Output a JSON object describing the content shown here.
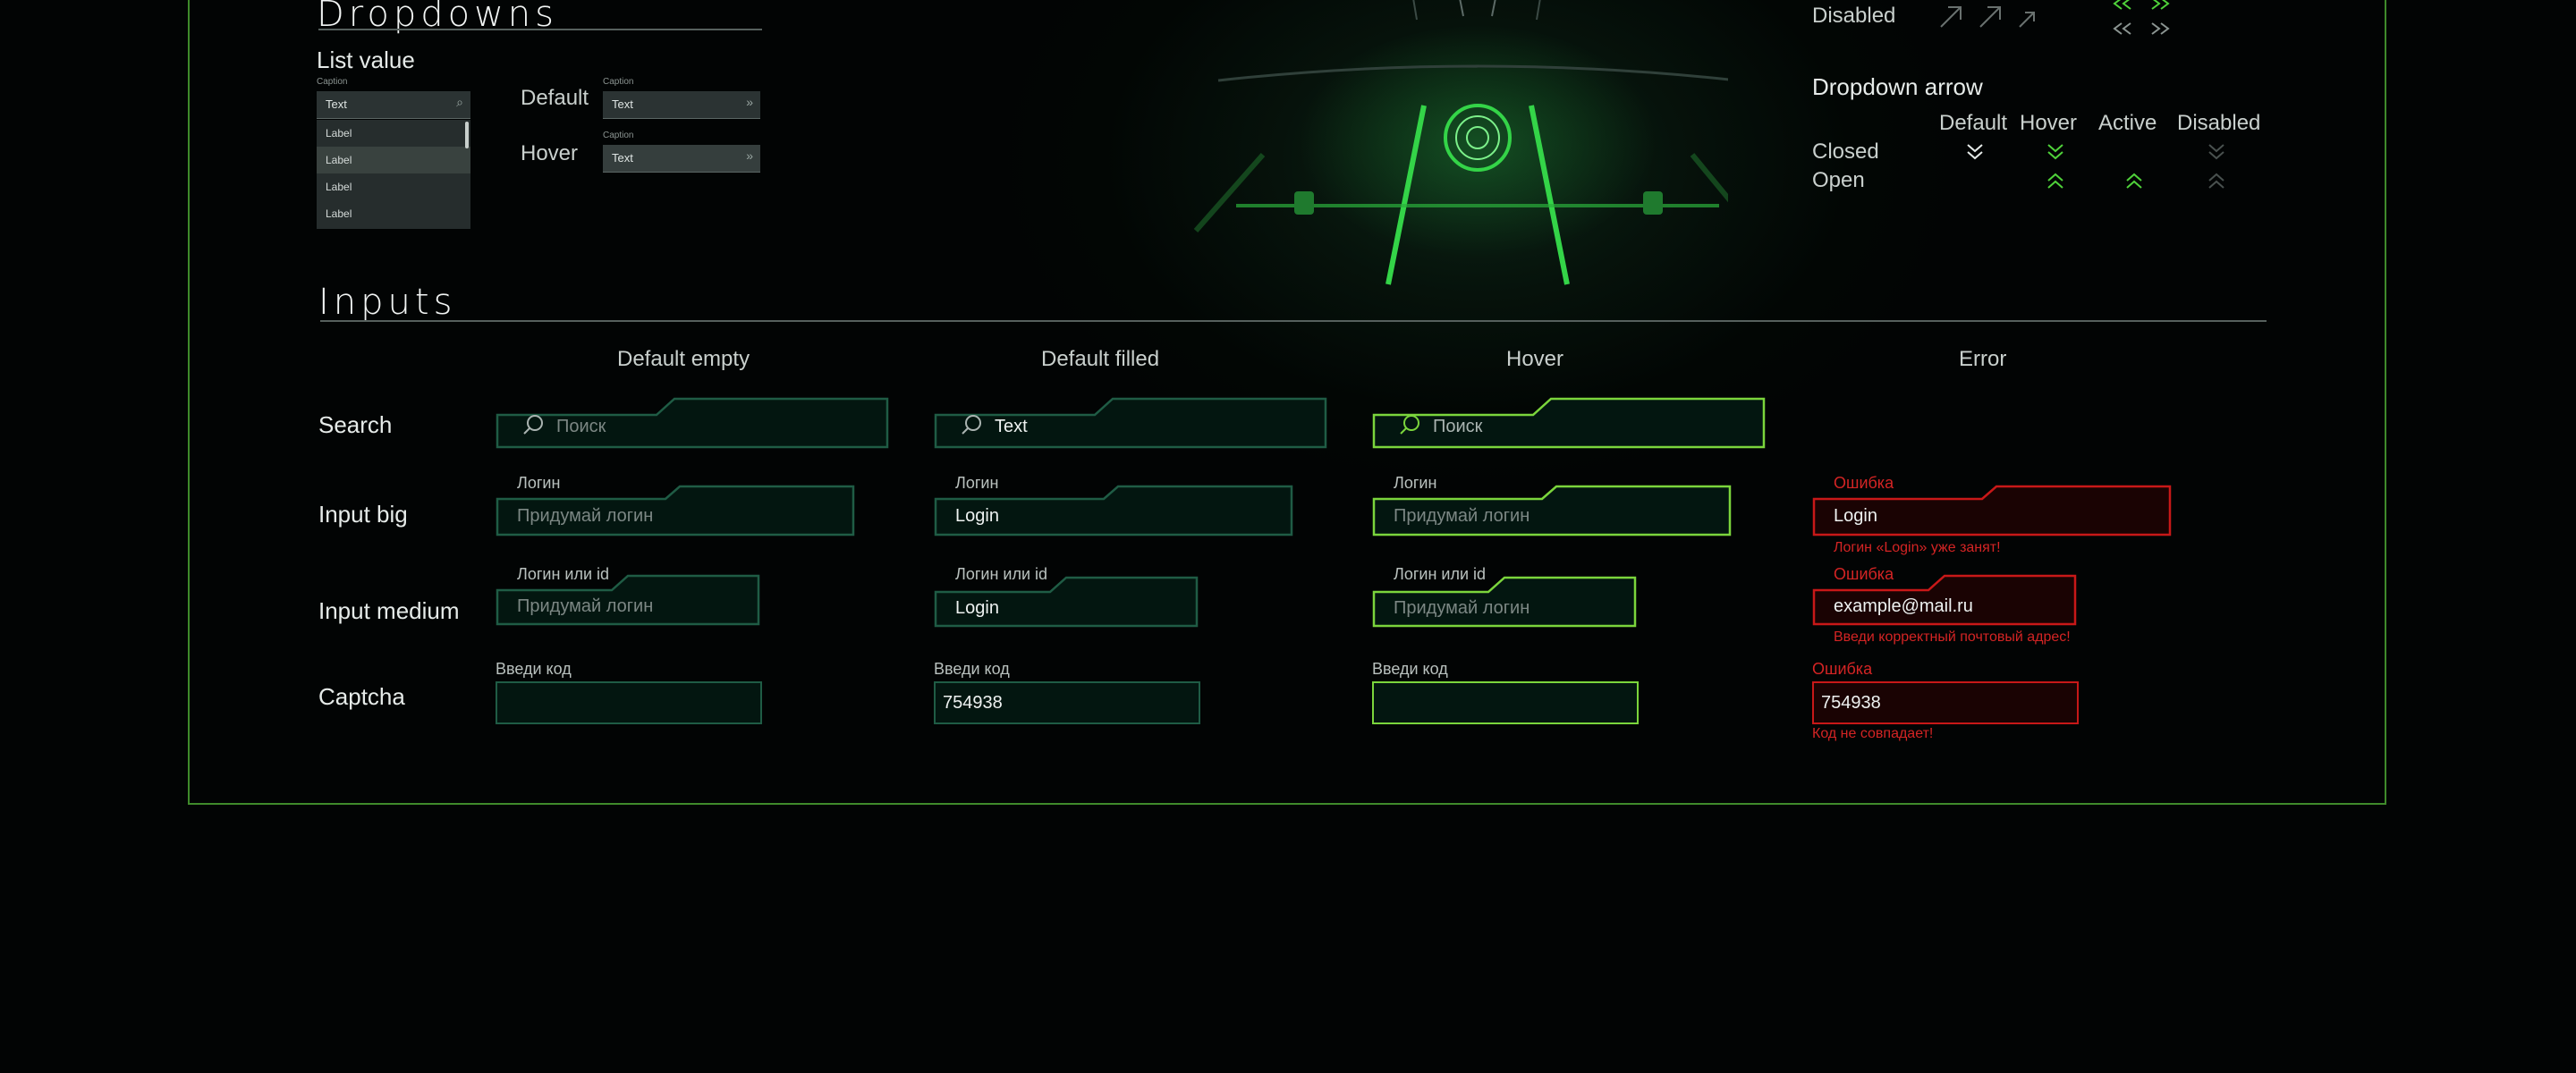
{
  "dropdowns": {
    "title": "Dropdowns",
    "list_value": {
      "title": "List value",
      "caption": "Caption",
      "value": "Text",
      "items": [
        "Label",
        "Label",
        "Label",
        "Label"
      ]
    },
    "states": [
      {
        "label": "Default",
        "caption": "Caption",
        "value": "Text"
      },
      {
        "label": "Hover",
        "caption": "Caption",
        "value": "Text"
      }
    ]
  },
  "arrows": {
    "disabled_label": "Disabled",
    "dropdown_arrow_title": "Dropdown arrow",
    "columns": [
      "Default",
      "Hover",
      "Active",
      "Disabled"
    ],
    "rows": [
      "Closed",
      "Open"
    ]
  },
  "inputs": {
    "title": "Inputs",
    "columns": [
      "Default empty",
      "Default filled",
      "Hover",
      "Error"
    ],
    "rows": [
      "Search",
      "Input big",
      "Input medium",
      "Captcha"
    ],
    "search": {
      "empty": "Поиск",
      "filled": "Text",
      "hover": "Поиск"
    },
    "big": {
      "label": "Логин",
      "placeholder": "Придумай логин",
      "value": "Login",
      "error_label": "Ошибка",
      "error_msg": "Логин «Login» уже занят!"
    },
    "medium": {
      "label": "Логин или id",
      "placeholder": "Придумай логин",
      "value": "Login",
      "error_label": "Ошибка",
      "error_value": "example@mail.ru",
      "error_msg": "Введи корректный почтовый адрес!"
    },
    "captcha": {
      "label": "Введи код",
      "value": "754938",
      "error_label": "Ошибка",
      "error_msg": "Код не совпадает!"
    }
  },
  "colors": {
    "default_border": "#1f5c45",
    "hover_border": "#7bd53c",
    "error_border": "#c81818",
    "accent_green": "#4fd23a",
    "frame_border": "#3f8a2b"
  }
}
